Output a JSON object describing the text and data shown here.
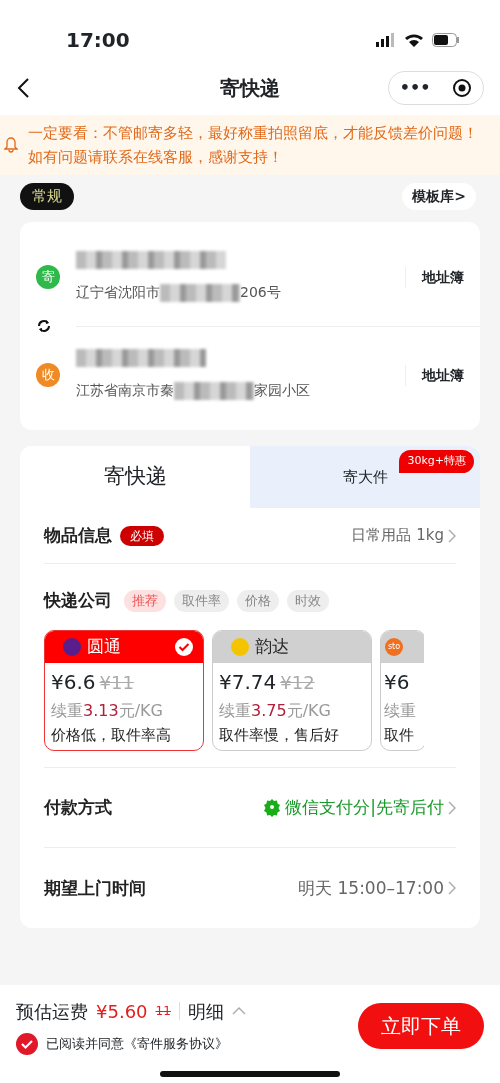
{
  "status_bar": {
    "time": "17:00"
  },
  "nav": {
    "title": "寄快递",
    "more": "•••"
  },
  "notice": {
    "text": "一定要看：不管邮寄多轻，最好称重拍照留底，才能反馈差价问题！如有问题请联系在线客服，感谢支持！"
  },
  "mode": {
    "label": "常规",
    "template": "模板库>"
  },
  "addresses": [
    {
      "badge": "寄",
      "color": "#2fb94a",
      "address_start": "辽宁省沈阳市",
      "address_end": "206号",
      "book": "地址簿"
    },
    {
      "badge": "收",
      "color": "#f08a24",
      "address_start": "江苏省南京市秦",
      "address_end": "家园小区",
      "book": "地址簿"
    }
  ],
  "tabs": [
    {
      "label": "寄快递",
      "selected": true
    },
    {
      "label": "寄大件",
      "selected": false,
      "badge": "30kg+特惠"
    }
  ],
  "item_info": {
    "label": "物品信息",
    "required": "必填",
    "value": "日常用品 1kg"
  },
  "carrier_section": {
    "label": "快递公司",
    "filters": [
      {
        "label": "推荐",
        "selected": true
      },
      {
        "label": "取件率",
        "selected": false
      },
      {
        "label": "价格",
        "selected": false
      },
      {
        "label": "时效",
        "selected": false
      }
    ]
  },
  "carriers": [
    {
      "name": "圆通",
      "color": "#5a1e8c",
      "selected": true,
      "price": "¥6.6",
      "old_price": "¥11",
      "renew_prefix": "续重",
      "renew_amount": "3.13",
      "renew_unit": "元/KG",
      "note": "价格低，取件率高"
    },
    {
      "name": "韵达",
      "color": "#f5c400",
      "selected": false,
      "price": "¥7.74",
      "old_price": "¥12",
      "renew_prefix": "续重",
      "renew_amount": "3.75",
      "renew_unit": "元/KG",
      "note": "取件率慢，售后好"
    },
    {
      "logo_text": "sto",
      "color": "#f07020",
      "selected": false,
      "price": "¥6",
      "renew_prefix": "续重",
      "note": "取件"
    }
  ],
  "payment": {
    "label": "付款方式",
    "value": "微信支付分|先寄后付"
  },
  "pickup": {
    "label": "期望上门时间",
    "value": "明天 15:00–17:00"
  },
  "footer": {
    "fee_label": "预估运费",
    "fee": "¥5.60",
    "old_fee": "11",
    "detail": "明细",
    "agree_checked": true,
    "agreement": "已阅读并同意《寄件服务协议》",
    "submit": "立即下单"
  }
}
